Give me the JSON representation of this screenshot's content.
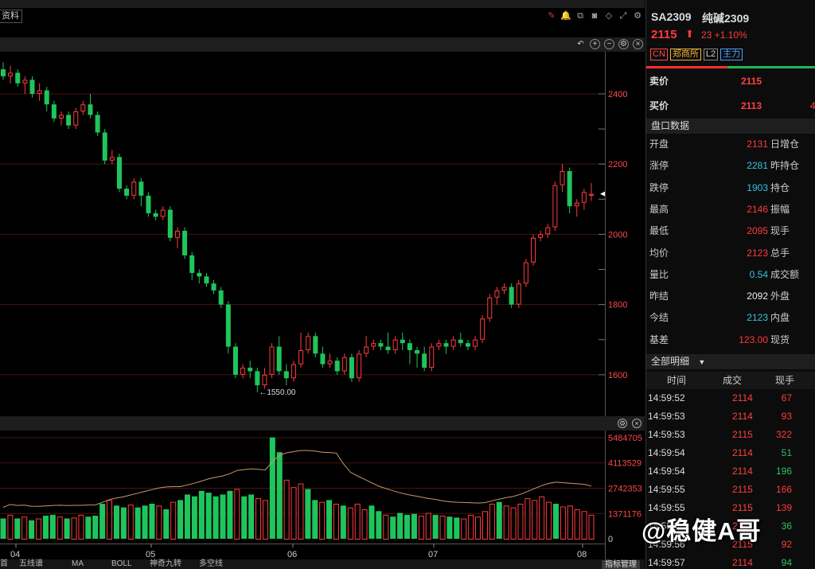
{
  "toolbar": {
    "tag_label": "资料"
  },
  "main_chart": {
    "y_ticks": [
      "2400",
      "2200",
      "2000",
      "1800",
      "1600"
    ],
    "low_marker": "←1550.00"
  },
  "volume_chart": {
    "y_ticks": [
      "5484705",
      "4113529",
      "2742353",
      "1371176",
      "0"
    ],
    "x_ticks": [
      "04",
      "05",
      "06",
      "07",
      "08"
    ]
  },
  "bottom_tabs": [
    "首",
    "五线谱",
    "MA",
    "BOLL",
    "神奇九转",
    "多空线"
  ],
  "indicator_manager_label": "指标管理",
  "colors": {
    "up": "#ff3b3b",
    "down": "#1fc55c",
    "grid": "#4a1515",
    "avg_line": "#c69a6a"
  },
  "chart_data": [
    {
      "type": "candlestick",
      "title": "",
      "ylim": [
        1500,
        2520
      ],
      "ticks": [
        1600,
        1800,
        2000,
        2200,
        2400
      ],
      "low_label_value": 1550,
      "candles": [
        [
          2470,
          2450,
          2490,
          2440
        ],
        [
          2450,
          2460,
          2480,
          2430
        ],
        [
          2460,
          2430,
          2470,
          2420
        ],
        [
          2430,
          2440,
          2450,
          2400
        ],
        [
          2440,
          2400,
          2450,
          2390
        ],
        [
          2400,
          2410,
          2430,
          2380
        ],
        [
          2410,
          2370,
          2420,
          2350
        ],
        [
          2370,
          2330,
          2380,
          2320
        ],
        [
          2330,
          2340,
          2350,
          2310
        ],
        [
          2340,
          2310,
          2350,
          2300
        ],
        [
          2310,
          2350,
          2360,
          2300
        ],
        [
          2350,
          2370,
          2380,
          2340
        ],
        [
          2370,
          2340,
          2400,
          2330
        ],
        [
          2340,
          2290,
          2350,
          2280
        ],
        [
          2290,
          2210,
          2300,
          2200
        ],
        [
          2210,
          2220,
          2240,
          2200
        ],
        [
          2220,
          2130,
          2230,
          2120
        ],
        [
          2130,
          2110,
          2140,
          2100
        ],
        [
          2110,
          2150,
          2160,
          2100
        ],
        [
          2150,
          2110,
          2160,
          2080
        ],
        [
          2110,
          2060,
          2120,
          2050
        ],
        [
          2060,
          2050,
          2070,
          2040
        ],
        [
          2050,
          2070,
          2080,
          2040
        ],
        [
          2070,
          1990,
          2080,
          1980
        ],
        [
          1990,
          2010,
          2020,
          1960
        ],
        [
          2010,
          1940,
          2020,
          1930
        ],
        [
          1940,
          1890,
          1950,
          1870
        ],
        [
          1890,
          1880,
          1900,
          1860
        ],
        [
          1880,
          1860,
          1890,
          1850
        ],
        [
          1860,
          1840,
          1870,
          1830
        ],
        [
          1840,
          1800,
          1850,
          1790
        ],
        [
          1800,
          1680,
          1810,
          1660
        ],
        [
          1680,
          1600,
          1690,
          1590
        ],
        [
          1600,
          1620,
          1630,
          1590
        ],
        [
          1620,
          1610,
          1640,
          1590
        ],
        [
          1610,
          1570,
          1620,
          1550
        ],
        [
          1570,
          1600,
          1620,
          1560
        ],
        [
          1600,
          1680,
          1690,
          1590
        ],
        [
          1680,
          1610,
          1710,
          1600
        ],
        [
          1610,
          1590,
          1630,
          1570
        ],
        [
          1590,
          1630,
          1640,
          1580
        ],
        [
          1630,
          1670,
          1720,
          1620
        ],
        [
          1670,
          1710,
          1720,
          1660
        ],
        [
          1710,
          1660,
          1720,
          1650
        ],
        [
          1660,
          1630,
          1680,
          1620
        ],
        [
          1630,
          1640,
          1660,
          1620
        ],
        [
          1640,
          1610,
          1650,
          1600
        ],
        [
          1610,
          1650,
          1660,
          1600
        ],
        [
          1650,
          1590,
          1660,
          1580
        ],
        [
          1590,
          1660,
          1670,
          1580
        ],
        [
          1660,
          1680,
          1710,
          1650
        ],
        [
          1680,
          1690,
          1700,
          1670
        ],
        [
          1690,
          1680,
          1700,
          1670
        ],
        [
          1680,
          1670,
          1720,
          1660
        ],
        [
          1670,
          1700,
          1710,
          1660
        ],
        [
          1700,
          1690,
          1720,
          1670
        ],
        [
          1690,
          1670,
          1700,
          1630
        ],
        [
          1670,
          1660,
          1680,
          1620
        ],
        [
          1660,
          1620,
          1680,
          1610
        ],
        [
          1620,
          1680,
          1690,
          1610
        ],
        [
          1680,
          1690,
          1700,
          1670
        ],
        [
          1690,
          1680,
          1700,
          1660
        ],
        [
          1680,
          1700,
          1710,
          1670
        ],
        [
          1700,
          1690,
          1720,
          1680
        ],
        [
          1690,
          1680,
          1700,
          1670
        ],
        [
          1680,
          1700,
          1710,
          1670
        ],
        [
          1700,
          1760,
          1770,
          1690
        ],
        [
          1760,
          1820,
          1830,
          1750
        ],
        [
          1820,
          1840,
          1850,
          1800
        ],
        [
          1840,
          1850,
          1860,
          1830
        ],
        [
          1850,
          1800,
          1860,
          1790
        ],
        [
          1800,
          1860,
          1870,
          1790
        ],
        [
          1860,
          1920,
          1930,
          1850
        ],
        [
          1920,
          1990,
          2000,
          1910
        ],
        [
          1990,
          2000,
          2010,
          1980
        ],
        [
          2000,
          2020,
          2030,
          1990
        ],
        [
          2020,
          2140,
          2150,
          2010
        ],
        [
          2140,
          2180,
          2200,
          2120
        ],
        [
          2180,
          2080,
          2190,
          2060
        ],
        [
          2080,
          2090,
          2100,
          2050
        ],
        [
          2090,
          2120,
          2130,
          2070
        ],
        [
          2110,
          2115,
          2146,
          2095
        ]
      ]
    },
    {
      "type": "bar",
      "title": "",
      "ylim": [
        0,
        5484705
      ],
      "ticks": [
        0,
        1371176,
        2742353,
        4113529,
        5484705
      ],
      "values": [
        1100000,
        1300000,
        1100000,
        1200000,
        1000000,
        1100000,
        1250000,
        1300000,
        1200000,
        1100000,
        1150000,
        1300000,
        1200000,
        1250000,
        1900000,
        2100000,
        1800000,
        1700000,
        1850000,
        1700000,
        1800000,
        1900000,
        1800000,
        1600000,
        2000000,
        2100000,
        2400000,
        2300000,
        2600000,
        2500000,
        2300000,
        2400000,
        2600000,
        2700000,
        2300000,
        2400000,
        2200000,
        2100000,
        5500000,
        4700000,
        3200000,
        2800000,
        3000000,
        2700000,
        2100000,
        2000000,
        2100000,
        1900000,
        1800000,
        1700000,
        1900000,
        1600000,
        1800000,
        1500000,
        1300000,
        1200000,
        1400000,
        1300000,
        1350000,
        1250000,
        1400000,
        1300000,
        1250000,
        1200000,
        1150000,
        1100000,
        1300000,
        1200000,
        1500000,
        1900000,
        2000000,
        1800000,
        1700000,
        1900000,
        2200000,
        2100000,
        2300000,
        2000000,
        1900000,
        1750000,
        1800000,
        1600000,
        1500000,
        1300000
      ],
      "avg_line_name": ""
    }
  ],
  "panel": {
    "symbol": "SA2309",
    "name": "纯碱2309",
    "price": "2115",
    "arrow": "⬆",
    "change": "23 +1.10%",
    "badges": [
      "CN",
      "郑商所",
      "L2",
      "主力"
    ],
    "orderbook": [
      {
        "label": "卖价",
        "value": "2115",
        "extra": ""
      },
      {
        "label": "买价",
        "value": "2113",
        "extra": "4"
      }
    ],
    "quote_header": "盘口数据",
    "quote_rows": [
      {
        "label": "开盘",
        "value": "2131",
        "color": "red",
        "label2": "日增仓"
      },
      {
        "label": "涨停",
        "value": "2281",
        "color": "cyan",
        "label2": "昨持仓"
      },
      {
        "label": "跌停",
        "value": "1903",
        "color": "cyan",
        "label2": "持仓"
      },
      {
        "label": "最高",
        "value": "2146",
        "color": "red",
        "label2": "振幅"
      },
      {
        "label": "最低",
        "value": "2095",
        "color": "red",
        "label2": "现手"
      },
      {
        "label": "均价",
        "value": "2123",
        "color": "red",
        "label2": "总手"
      },
      {
        "label": "量比",
        "value": "0.54",
        "color": "cyan",
        "label2": "成交额"
      },
      {
        "label": "昨结",
        "value": "2092",
        "color": "white",
        "label2": "外盘"
      },
      {
        "label": "今结",
        "value": "2123",
        "color": "cyan",
        "label2": "内盘"
      },
      {
        "label": "基差",
        "value": "123.00",
        "color": "red",
        "label2": "现货"
      }
    ],
    "detail_header": "全部明细",
    "trade_cols": [
      "时间",
      "成交",
      "现手"
    ],
    "trades": [
      {
        "time": "14:59:52",
        "price": "2114",
        "qty": "67",
        "color": "red"
      },
      {
        "time": "14:59:53",
        "price": "2114",
        "qty": "93",
        "color": "red"
      },
      {
        "time": "14:59:53",
        "price": "2115",
        "qty": "322",
        "color": "red"
      },
      {
        "time": "14:59:54",
        "price": "2114",
        "qty": "51",
        "color": "green"
      },
      {
        "time": "14:59:54",
        "price": "2114",
        "qty": "196",
        "color": "green"
      },
      {
        "time": "14:59:55",
        "price": "2115",
        "qty": "166",
        "color": "red"
      },
      {
        "time": "14:59:55",
        "price": "2115",
        "qty": "139",
        "color": "red"
      },
      {
        "time": "14:59:56",
        "price": "2114",
        "qty": "36",
        "color": "green"
      },
      {
        "time": "14:59:56",
        "price": "2115",
        "qty": "92",
        "color": "red"
      },
      {
        "time": "14:59:57",
        "price": "2114",
        "qty": "94",
        "color": "green"
      }
    ]
  },
  "watermark": "@稳健A哥"
}
